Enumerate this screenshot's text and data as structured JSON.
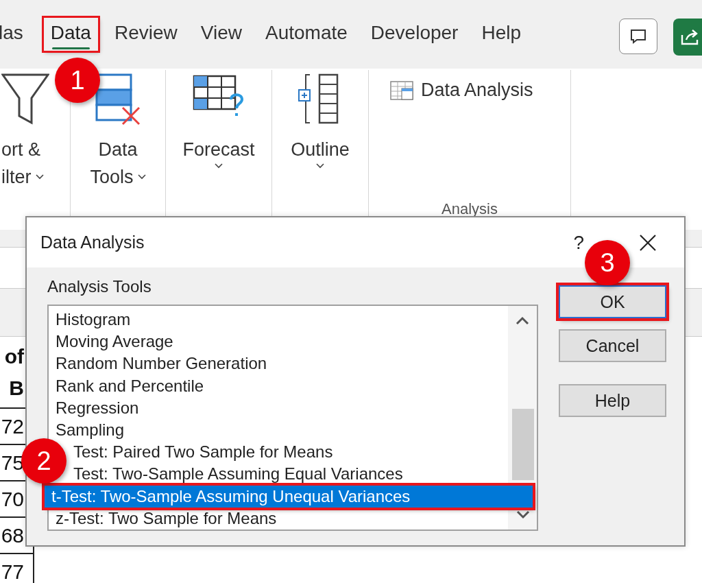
{
  "ribbon": {
    "tabs": [
      {
        "label": "las",
        "selected": false,
        "highlighted": false
      },
      {
        "label": "Data",
        "selected": true,
        "highlighted": true
      },
      {
        "label": "Review",
        "selected": false,
        "highlighted": false
      },
      {
        "label": "View",
        "selected": false,
        "highlighted": false
      },
      {
        "label": "Automate",
        "selected": false,
        "highlighted": false
      },
      {
        "label": "Developer",
        "selected": false,
        "highlighted": false
      },
      {
        "label": "Help",
        "selected": false,
        "highlighted": false
      }
    ],
    "groups": [
      {
        "kind": "filter",
        "lines": [
          "ort &",
          "ilter"
        ]
      },
      {
        "kind": "data-tools",
        "lines": [
          "Data",
          "Tools"
        ]
      },
      {
        "kind": "forecast",
        "lines": [
          "Forecast"
        ]
      },
      {
        "kind": "outline",
        "lines": [
          "Outline"
        ]
      },
      {
        "kind": "analysis",
        "command": "Data Analysis",
        "group_label": "Analysis"
      }
    ]
  },
  "sheet": {
    "cells": [
      {
        "kind": "header",
        "lines": [
          "of",
          "B"
        ]
      },
      {
        "kind": "value",
        "lines": [
          "72"
        ]
      },
      {
        "kind": "value",
        "lines": [
          "75"
        ]
      },
      {
        "kind": "value",
        "lines": [
          "70"
        ]
      },
      {
        "kind": "value",
        "lines": [
          "68"
        ]
      },
      {
        "kind": "value",
        "lines": [
          "77"
        ]
      }
    ]
  },
  "dialog": {
    "title": "Data Analysis",
    "help_glyph": "?",
    "list_label": "Analysis Tools",
    "items": [
      {
        "label": "Histogram",
        "selected": false,
        "kind": "full"
      },
      {
        "label": "Moving Average",
        "selected": false,
        "kind": "full"
      },
      {
        "label": "Random Number Generation",
        "selected": false,
        "kind": "full"
      },
      {
        "label": "Rank and Percentile",
        "selected": false,
        "kind": "full"
      },
      {
        "label": "Regression",
        "selected": false,
        "kind": "full"
      },
      {
        "label": "Sampling",
        "selected": false,
        "kind": "full"
      },
      {
        "label": "Test: Paired Two Sample for Means",
        "selected": false,
        "kind": "covered"
      },
      {
        "label": "Test: Two-Sample Assuming Equal Variances",
        "selected": false,
        "kind": "covered"
      },
      {
        "label": "t-Test: Two-Sample Assuming Unequal Variances",
        "selected": true,
        "kind": "full"
      },
      {
        "label": "z-Test: Two Sample for Means",
        "selected": false,
        "kind": "full"
      }
    ],
    "buttons": [
      {
        "label": "OK",
        "default": true,
        "highlighted": true
      },
      {
        "label": "Cancel",
        "default": false,
        "highlighted": false
      },
      {
        "label": "Help",
        "default": false,
        "highlighted": false
      }
    ]
  },
  "annotations": [
    {
      "text": "1"
    },
    {
      "text": "2"
    },
    {
      "text": "3"
    }
  ]
}
